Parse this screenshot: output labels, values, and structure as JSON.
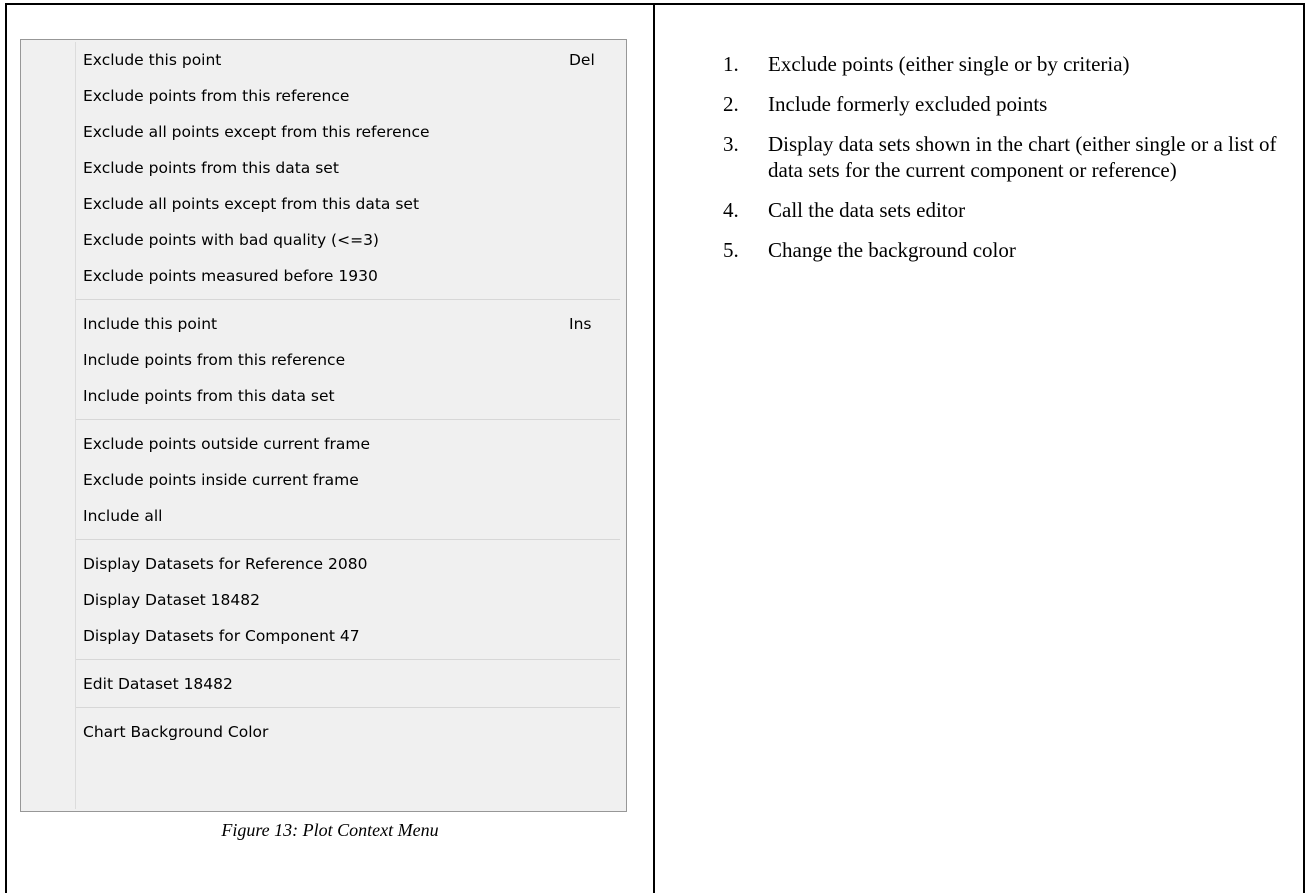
{
  "menu": {
    "groups": [
      {
        "items": [
          {
            "label": "Exclude this point",
            "shortcut": "Del"
          },
          {
            "label": "Exclude points from this reference",
            "shortcut": ""
          },
          {
            "label": "Exclude all points except from this reference",
            "shortcut": ""
          },
          {
            "label": "Exclude points from this data set",
            "shortcut": ""
          },
          {
            "label": "Exclude all points except from this data set",
            "shortcut": ""
          },
          {
            "label": "Exclude points with bad quality (<=3)",
            "shortcut": ""
          },
          {
            "label": "Exclude points measured before 1930",
            "shortcut": ""
          }
        ]
      },
      {
        "items": [
          {
            "label": "Include this point",
            "shortcut": "Ins"
          },
          {
            "label": "Include points from this reference",
            "shortcut": ""
          },
          {
            "label": "Include points from this data set",
            "shortcut": ""
          }
        ]
      },
      {
        "items": [
          {
            "label": "Exclude points outside current frame",
            "shortcut": ""
          },
          {
            "label": "Exclude points inside current frame",
            "shortcut": ""
          },
          {
            "label": "Include all",
            "shortcut": ""
          }
        ]
      },
      {
        "items": [
          {
            "label": "Display Datasets for Reference 2080",
            "shortcut": ""
          },
          {
            "label": "Display Dataset 18482",
            "shortcut": ""
          },
          {
            "label": "Display Datasets for Component 47",
            "shortcut": ""
          }
        ]
      },
      {
        "items": [
          {
            "label": "Edit Dataset 18482",
            "shortcut": ""
          }
        ]
      },
      {
        "items": [
          {
            "label": "Chart Background Color",
            "shortcut": ""
          }
        ]
      }
    ]
  },
  "caption": "Figure 13: Plot Context Menu",
  "steps": [
    {
      "num": "1.",
      "text": "Exclude points (either single or by criteria)"
    },
    {
      "num": "2.",
      "text": "Include formerly excluded points"
    },
    {
      "num": "3.",
      "text": "Display data sets shown in the chart (either single or a list of data sets for the current component or reference)"
    },
    {
      "num": "4.",
      "text": "Call the data sets editor"
    },
    {
      "num": "5.",
      "text": "Change the background color"
    }
  ]
}
